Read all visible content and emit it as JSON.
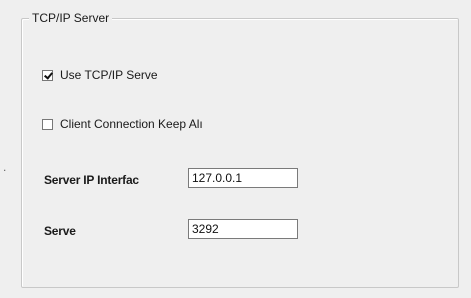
{
  "stray_mark": ".",
  "tcp_server": {
    "title": "TCP/IP Server",
    "use_tcp": {
      "label": "Use TCP/IP Serve",
      "checked": true
    },
    "keep_alive": {
      "label": "Client Connection Keep Alı",
      "checked": false
    },
    "server_ip": {
      "label": "Server IP Interfac",
      "value": "127.0.0.1"
    },
    "server_port": {
      "label": "Serve",
      "value": "3292"
    }
  }
}
